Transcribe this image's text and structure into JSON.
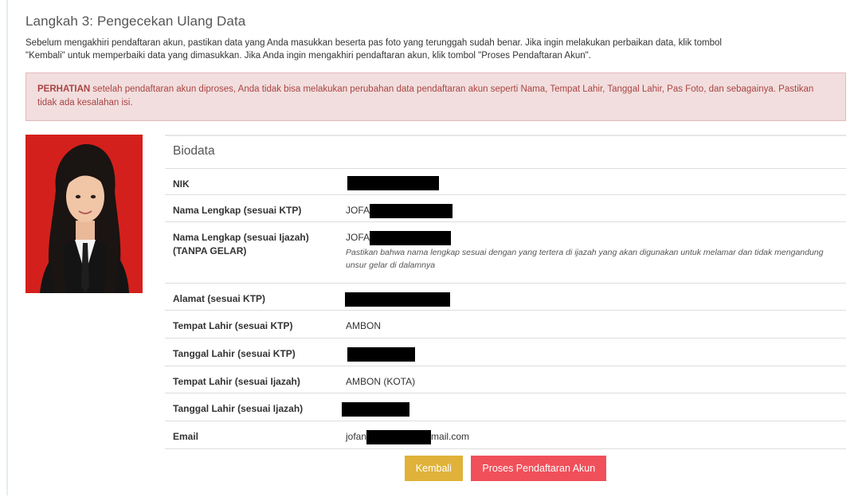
{
  "step": {
    "title": "Langkah 3: Pengecekan Ulang Data",
    "intro_line1": "Sebelum mengakhiri pendaftaran akun, pastikan data yang Anda masukkan beserta pas foto yang terunggah sudah benar. Jika ingin melakukan perbaikan data, klik tombol",
    "intro_line2": "\"Kembali\" untuk memperbaiki data yang dimasukkan. Jika Anda ingin mengakhiri pendaftaran akun, klik tombol \"Proses Pendaftaran Akun\"."
  },
  "alert": {
    "strong": "PERHATIAN",
    "text": " setelah pendaftaran akun diproses, Anda tidak bisa melakukan perubahan data pendaftaran akun seperti Nama, Tempat Lahir, Tanggal Lahir, Pas Foto, dan sebagainya. Pastikan tidak ada kesalahan isi."
  },
  "biodata": {
    "heading": "Biodata",
    "rows": {
      "nik": {
        "label": "NIK"
      },
      "nama_ktp": {
        "label": "Nama Lengkap (sesuai KTP)",
        "prefix": "JOFA"
      },
      "nama_ijazah": {
        "label_line1": "Nama Lengkap (sesuai Ijazah)",
        "label_line2": "(TANPA GELAR)",
        "prefix": "JOFA",
        "hint": "Pastikan bahwa nama lengkap sesuai dengan yang tertera di ijazah yang akan digunakan untuk melamar dan tidak mengandung unsur gelar di dalamnya"
      },
      "alamat": {
        "label": "Alamat (sesuai KTP)"
      },
      "tempat_ktp": {
        "label": "Tempat Lahir (sesuai KTP)",
        "value": "AMBON"
      },
      "tanggal_ktp": {
        "label": "Tanggal Lahir (sesuai KTP)"
      },
      "tempat_ijazah": {
        "label": "Tempat Lahir (sesuai Ijazah)",
        "value": "AMBON (KOTA)"
      },
      "tanggal_ijazah": {
        "label": "Tanggal Lahir (sesuai Ijazah)"
      },
      "email": {
        "label": "Email",
        "prefix": "jofan",
        "suffix": "mail.com"
      }
    }
  },
  "buttons": {
    "back": "Kembali",
    "process": "Proses Pendaftaran Akun"
  },
  "colors": {
    "alert_bg": "#f2dede",
    "alert_text": "#a94442",
    "photo_bg": "#d4201c",
    "back_button": "#e0b23a",
    "process_button": "#f0505a"
  }
}
